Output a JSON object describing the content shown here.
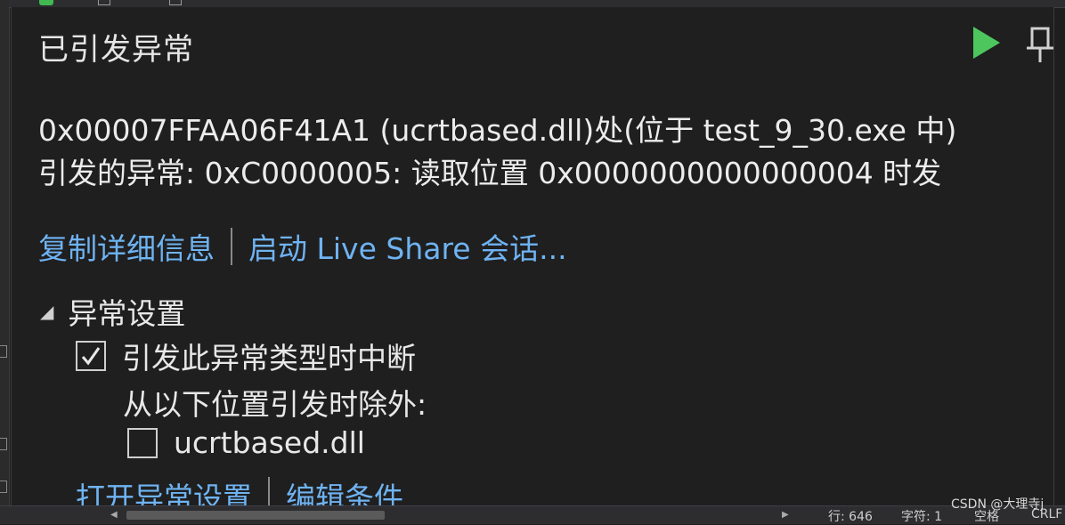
{
  "dialog": {
    "title": "已引发异常",
    "message_line1": "0x00007FFAA06F41A1 (ucrtbased.dll)处(位于 test_9_30.exe 中)",
    "message_line2": "引发的异常: 0xC0000005: 读取位置 0x0000000000000004 时发",
    "links": {
      "copy_details": "复制详细信息",
      "live_share": "启动 Live Share 会话..."
    },
    "exception_settings": {
      "header": "异常设置",
      "break_when_thrown": {
        "label": "引发此异常类型时中断",
        "checked": true
      },
      "except_label": "从以下位置引发时除外:",
      "module": {
        "label": "ucrtbased.dll",
        "checked": false
      },
      "open_settings": "打开异常设置",
      "edit_conditions": "编辑条件"
    },
    "colors": {
      "play": "#4ec65e",
      "link": "#6fb3f2"
    },
    "icons": {
      "play": "play-icon",
      "pin": "pin-icon"
    }
  },
  "statusbar": {
    "line": "行: 646",
    "char": "字符: 1",
    "spaces": "空格",
    "eol": "CRLF"
  },
  "watermark": "CSDN @大理寺j"
}
